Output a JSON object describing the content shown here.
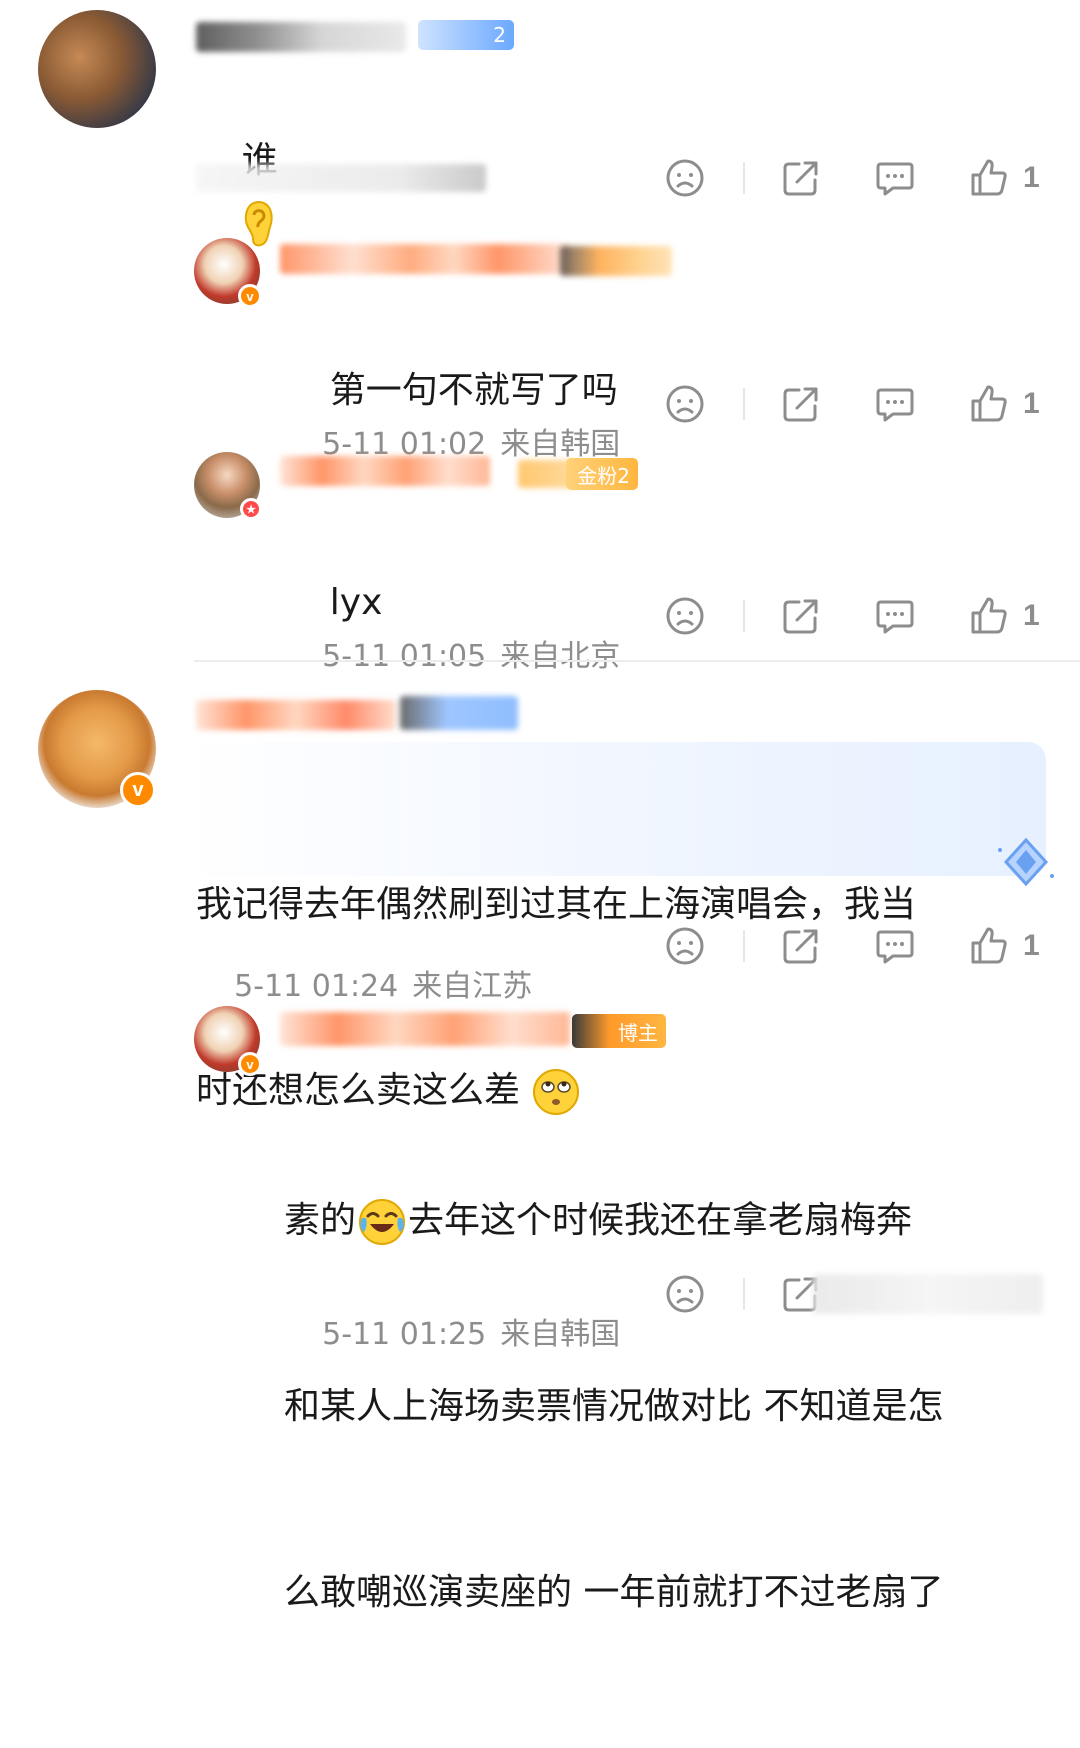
{
  "colors": {
    "meta_gray": "#8d8d8d",
    "vip_orange": "#ff8a00",
    "fan_badge_blue": "#6aa8ff",
    "fan_badge_gold": "#ffb640",
    "highlight_bubble": "#eaf3ff"
  },
  "comments": [
    {
      "id": "c1",
      "username_hidden": true,
      "fan_badge": "2",
      "content": [
        "谁"
      ],
      "content_emoji": "ear-emoji",
      "like_count": "1",
      "meta_hidden": true
    },
    {
      "id": "r1",
      "username_hidden": true,
      "content": [
        "第一句不就写了吗"
      ],
      "time": "5-11 01:02",
      "location": "来自韩国",
      "like_count": "1"
    },
    {
      "id": "r2",
      "username_hidden": true,
      "fan_badge": "金粉2",
      "content": [
        "lyx"
      ],
      "time": "5-11 01:05",
      "location": "来自北京",
      "like_count": "1"
    },
    {
      "id": "c2",
      "username_hidden": true,
      "content": [
        "我记得去年偶然刷到过其在上海演唱会，我当",
        "时还想怎么卖这么差"
      ],
      "content_emoji": "rolling-eyes-emoji",
      "time": "5-11 01:24",
      "location": "来自江苏",
      "like_count": "1"
    },
    {
      "id": "r3",
      "username_hidden": true,
      "fan_badge": "博主",
      "content_prefix": "素的",
      "content_emoji": "laughing-tears-emoji",
      "content": [
        "去年这个时候我还在拿老扇梅奔",
        "和某人上海场卖票情况做对比 不知道是怎",
        "么敢嘲巡演卖座的 一年前就打不过老扇了"
      ],
      "time": "5-11 01:25",
      "location": "来自韩国"
    }
  ]
}
